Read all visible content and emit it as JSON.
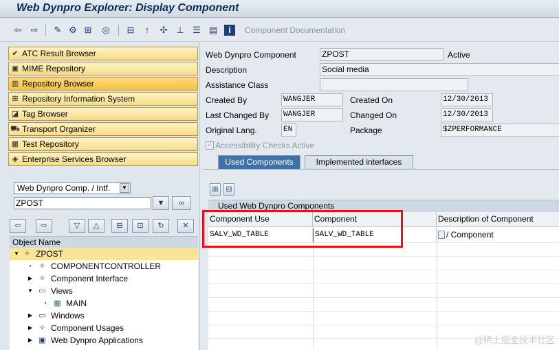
{
  "window": {
    "title": "Web Dynpro Explorer: Display Component"
  },
  "toolbar": {
    "icons": [
      "back-arrow-icon",
      "forward-arrow-icon",
      "edit-pencil-icon",
      "display-change-icon",
      "object-tree-icon",
      "where-used-icon",
      "hierarchy-icon",
      "activate-icon",
      "navigate-icon",
      "tree-icon",
      "stack-icon",
      "info-icon"
    ],
    "component_documentation": "Component Documentation"
  },
  "nav": {
    "items": [
      {
        "label": "ATC Result Browser",
        "icon": "atc-icon"
      },
      {
        "label": "MIME Repository",
        "icon": "mime-icon"
      },
      {
        "label": "Repository Browser",
        "icon": "repository-icon",
        "active": true
      },
      {
        "label": "Repository Information System",
        "icon": "info-system-icon"
      },
      {
        "label": "Tag Browser",
        "icon": "tag-icon"
      },
      {
        "label": "Transport Organizer",
        "icon": "transport-icon"
      },
      {
        "label": "Test Repository",
        "icon": "test-icon"
      },
      {
        "label": "Enterprise Services Browser",
        "icon": "enterprise-icon"
      }
    ],
    "object_type": "Web Dynpro Comp. / Intf.",
    "object_name": "ZPOST"
  },
  "tree": {
    "header": "Object Name",
    "nodes": [
      {
        "label": "ZPOST",
        "expanded": true,
        "selected": true
      },
      {
        "label": "COMPONENTCONTROLLER"
      },
      {
        "label": "Component Interface"
      },
      {
        "label": "Views",
        "expanded": true
      },
      {
        "label": "MAIN"
      },
      {
        "label": "Windows"
      },
      {
        "label": "Component Usages"
      },
      {
        "label": "Web Dynpro Applications"
      }
    ]
  },
  "form": {
    "component_label": "Web Dynpro Component",
    "component_value": "ZPOST",
    "status": "Active",
    "description_label": "Description",
    "description_value": "Social media",
    "assistance_label": "Assistance Class",
    "assistance_value": "",
    "created_by_label": "Created By",
    "created_by_value": "WANGJER",
    "created_on_label": "Created On",
    "created_on_value": "12/30/2013",
    "changed_by_label": "Last Changed By",
    "changed_by_value": "WANGJER",
    "changed_on_label": "Changed On",
    "changed_on_value": "12/30/2013",
    "lang_label": "Original Lang.",
    "lang_value": "EN",
    "package_label": "Package",
    "package_value": "$ZPERFORMANCE",
    "accessibility_label": "Accessibility Checks Active",
    "accessibility_checked": true
  },
  "tabs": [
    {
      "label": "Used Components",
      "active": true
    },
    {
      "label": "Implemented interfaces",
      "active": false
    }
  ],
  "grid": {
    "title": "Used Web Dynpro Components",
    "headers": [
      "Component Use",
      "Component",
      "Description of Component"
    ],
    "rows": [
      [
        "SALV_WD_TABLE",
        "SALV_WD_TABLE",
        "/ Component"
      ]
    ]
  },
  "watermark": "@稀土掘金技术社区",
  "colors": {
    "accent_tab": "#3f72a8",
    "highlight": "#e8101a",
    "nav_button": "#f5dc85"
  }
}
